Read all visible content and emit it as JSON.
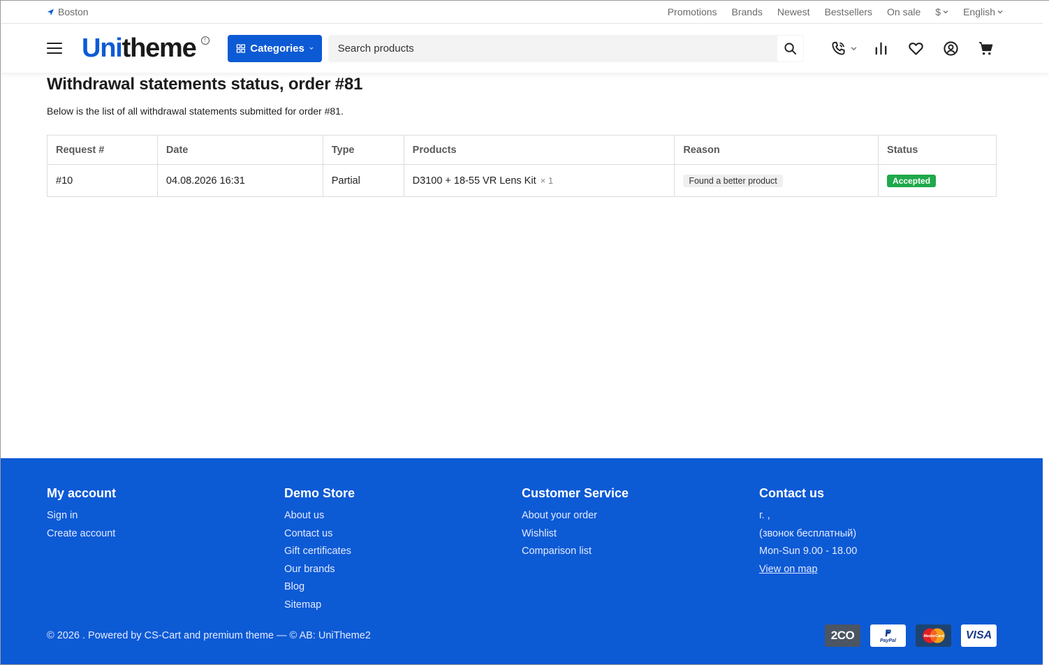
{
  "topbar": {
    "location": "Boston",
    "links": [
      "Promotions",
      "Brands",
      "Newest",
      "Bestsellers",
      "On sale"
    ],
    "currency": "$",
    "language": "English"
  },
  "header": {
    "logo_part1": "Uni",
    "logo_part2": "theme",
    "categories_label": "Categories",
    "search_placeholder": "Search products"
  },
  "page": {
    "title": "Withdrawal statements status, order #81",
    "description": "Below is the list of all withdrawal statements submitted for order #81."
  },
  "table": {
    "headers": [
      "Request #",
      "Date",
      "Type",
      "Products",
      "Reason",
      "Status"
    ],
    "rows": [
      {
        "request": "#10",
        "date": "04.08.2026 16:31",
        "type": "Partial",
        "product": "D3100 + 18-55 VR Lens Kit",
        "qty": "× 1",
        "reason": "Found a better product",
        "status": "Accepted"
      }
    ]
  },
  "footer": {
    "columns": [
      {
        "title": "My account",
        "items": [
          "Sign in",
          "Create account"
        ]
      },
      {
        "title": "Demo Store",
        "items": [
          "About us",
          "Contact us",
          "Gift certificates",
          "Our brands",
          "Blog",
          "Sitemap"
        ]
      },
      {
        "title": "Customer Service",
        "items": [
          "About your order",
          "Wishlist",
          "Comparison list"
        ]
      },
      {
        "title": "Contact us",
        "items": [
          "г. ,",
          "(звонок бесплатный)",
          "Mon-Sun 9.00 - 18.00",
          "View on map"
        ]
      }
    ],
    "copyright": "© 2026 . Powered by CS-Cart and premium theme — © AB: UniTheme2",
    "payments": [
      "2CO",
      "PayPal",
      "MasterCard",
      "VISA"
    ]
  },
  "colors": {
    "brand": "#0d5ad5",
    "status_accepted": "#1fa94a"
  }
}
